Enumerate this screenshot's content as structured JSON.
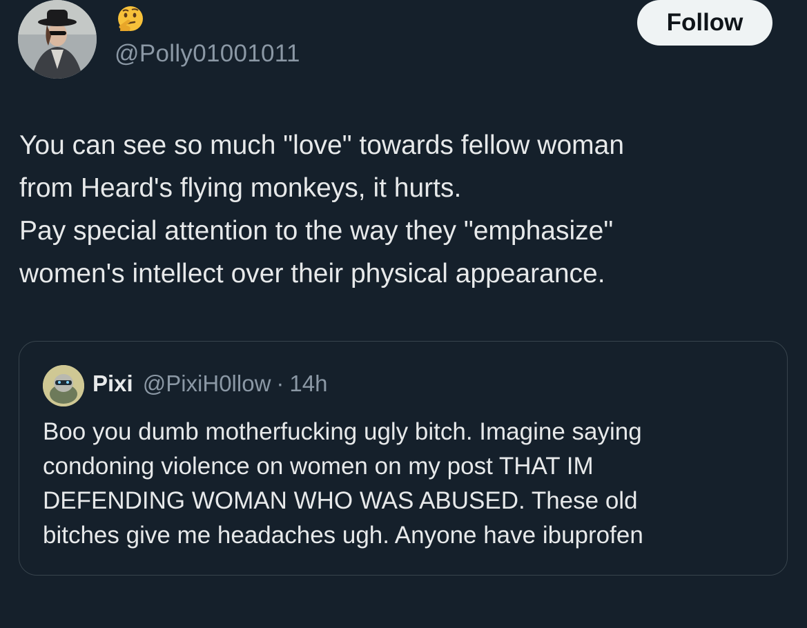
{
  "author": {
    "display_name_emoji": "thinking-face",
    "handle": "@Polly01001011",
    "avatar": "profile-photo-woman-in-hat"
  },
  "follow_label": "Follow",
  "tweet": {
    "lines": [
      "You can see so much \"love\" towards fellow woman",
      "from Heard's flying monkeys, it hurts.",
      "Pay special attention to the way they \"emphasize\"",
      "women's intellect over their physical appearance."
    ]
  },
  "quote": {
    "name": "Pixi",
    "handle": "@PixiH0llow",
    "separator": "·",
    "time": "14h",
    "avatar": "cartoon-avatar",
    "lines": [
      "Boo you dumb motherfucking ugly bitch. Imagine saying",
      "condoning violence on women on my post THAT IM",
      "DEFENDING WOMAN WHO WAS ABUSED. These old",
      "bitches give me headaches ugh. Anyone have ibuprofen"
    ]
  },
  "colors": {
    "background": "#15202b",
    "text": "#e7e9ea",
    "secondary_text": "#8b98a5",
    "border": "#38444d",
    "follow_bg": "#eff3f4"
  }
}
